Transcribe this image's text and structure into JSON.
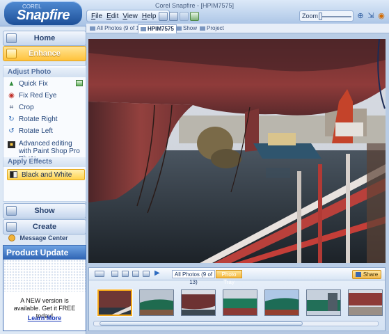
{
  "app": {
    "logo_sub": "COREL",
    "logo_main": "Snapfire",
    "window_title": "Corel Snapfire - [HPIM7575]"
  },
  "menu": [
    "File",
    "Edit",
    "View",
    "Help"
  ],
  "zoom": {
    "label": "Zoom"
  },
  "nav": {
    "home": "Home",
    "enhance": "Enhance",
    "show": "Show",
    "create": "Create",
    "message_center": "Message Center"
  },
  "enhance_panel": {
    "adjust_header": "Adjust Photo",
    "tasks": [
      {
        "label": "Quick Fix",
        "icon": "quick-fix-icon"
      },
      {
        "label": "Fix Red Eye",
        "icon": "red-eye-icon"
      },
      {
        "label": "Crop",
        "icon": "crop-icon"
      },
      {
        "label": "Rotate Right",
        "icon": "rotate-right-icon"
      },
      {
        "label": "Rotate Left",
        "icon": "rotate-left-icon"
      },
      {
        "label": "Advanced editing with Paint Shop Pro Photo",
        "icon": "psp-icon"
      }
    ],
    "effects_header": "Apply Effects",
    "effects": [
      {
        "label": "Black and White",
        "icon": "black-white-icon"
      }
    ]
  },
  "product_update": {
    "title": "Product Update",
    "text": "A NEW version is available. Get it FREE today!",
    "link": "Learn More"
  },
  "tabs": [
    {
      "label": "All Photos (9 of 13)"
    },
    {
      "label": "HPIM7575"
    },
    {
      "label": "Show"
    },
    {
      "label": "Project"
    }
  ],
  "filmstrip": {
    "all_photos": "All Photos (9 of 13)",
    "photo_tray": "Photo Tray",
    "share": "Share",
    "thumbnails_count": 7
  },
  "colors": {
    "accent": "#ffc23a",
    "brand": "#2e63b3"
  }
}
